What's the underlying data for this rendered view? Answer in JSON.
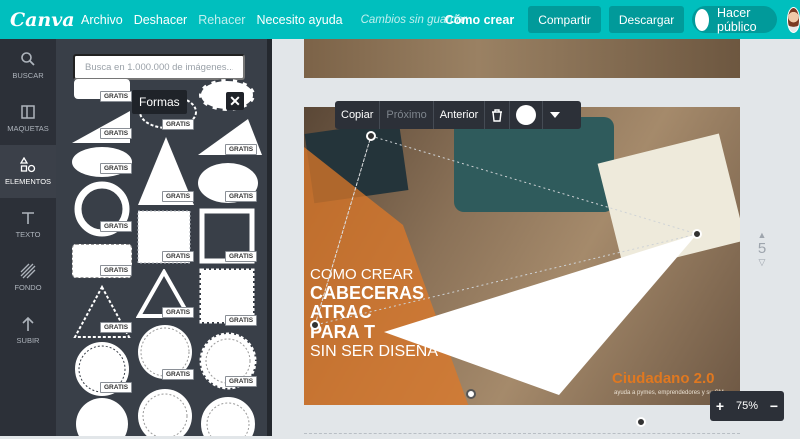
{
  "topbar": {
    "logo": "Canva",
    "file": "Archivo",
    "undo": "Deshacer",
    "redo": "Rehacer",
    "help": "Necesito ayuda",
    "saving": "Cambios sin guardar",
    "how": "Cómo crear",
    "share": "Compartir",
    "download": "Descargar",
    "publish": "Hacer público"
  },
  "nav": [
    {
      "label": "BUSCAR",
      "icon": "search-icon"
    },
    {
      "label": "MAQUETAS",
      "icon": "layout-icon"
    },
    {
      "label": "ELEMENTOS",
      "icon": "shapes-icon"
    },
    {
      "label": "TEXTO",
      "icon": "text-icon"
    },
    {
      "label": "FONDO",
      "icon": "background-icon"
    },
    {
      "label": "SUBIR",
      "icon": "upload-arrow-icon"
    }
  ],
  "panel": {
    "search_placeholder": "Busca en 1.000.000 de imágenes...",
    "tooltip": "Formas",
    "close": "✕",
    "gratis": "GRATIS"
  },
  "context_toolbar": {
    "copy": "Copiar",
    "forward": "Próximo",
    "back": "Anterior"
  },
  "design": {
    "line1": "COMO CREAR",
    "line2": "CABECERAS",
    "line3": "ATRAC",
    "line4": "PARA T",
    "line5": "SIN SER DISEÑA",
    "brand": "Ciudadano 2.0",
    "brand_sub": "ayuda a pymes, emprendedores y su CM"
  },
  "page_number": "5",
  "zoom": {
    "plus": "+",
    "level": "75%",
    "minus": "−"
  }
}
